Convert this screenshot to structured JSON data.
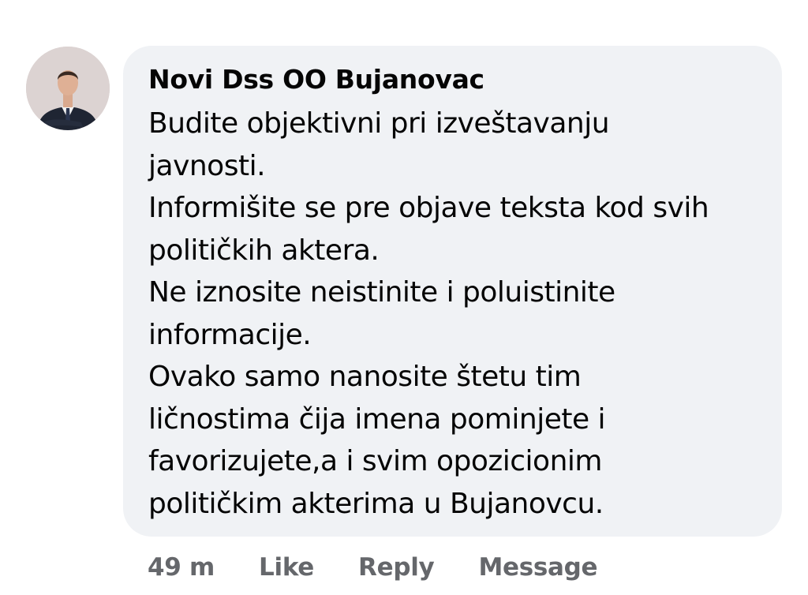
{
  "comment": {
    "author": "Novi Dss OO Bujanovac",
    "lines": [
      "Budite objektivni pri izveštavanju",
      "javnosti.",
      "Informišite se pre objave teksta kod svih",
      "političkih aktera.",
      "Ne iznosite neistinite i poluistinite",
      "informacije.",
      "Ovako samo nanosite štetu tim",
      "ličnostima čija imena pominjete i",
      "favorizujete,a i svim opozicionim",
      "političkim akterima u Bujanovcu."
    ],
    "avatar_icon": "profile-photo-man-in-suit"
  },
  "actions": {
    "time": "49 m",
    "like": "Like",
    "reply": "Reply",
    "message": "Message"
  },
  "colors": {
    "bubble": "#f0f2f5",
    "text": "#050505",
    "secondary": "#65676b"
  }
}
